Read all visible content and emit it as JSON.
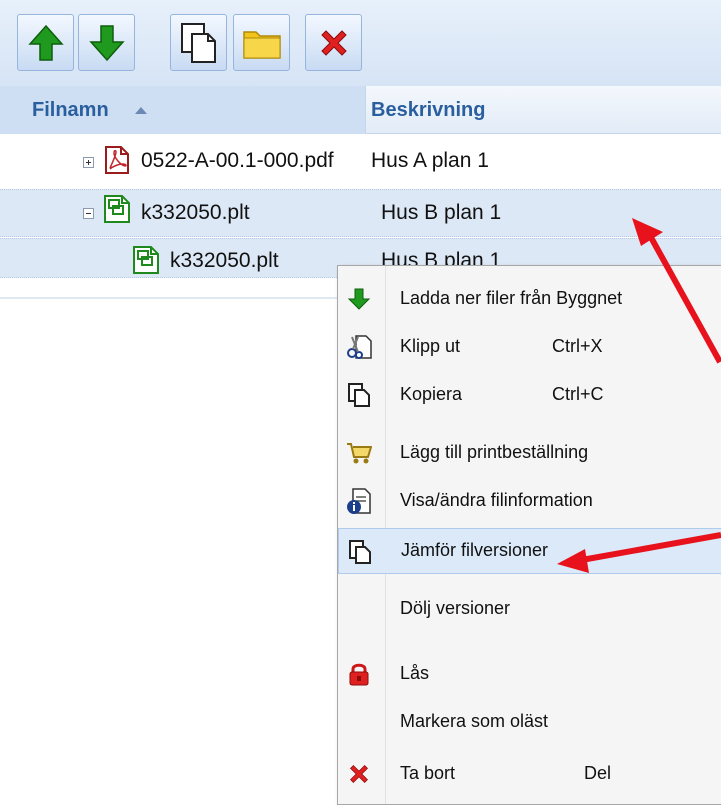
{
  "toolbar": {
    "buttons": [
      {
        "icon": "arrow-up-icon",
        "color": "#1f9a1f"
      },
      {
        "icon": "arrow-down-icon",
        "color": "#1f9a1f"
      },
      {
        "icon": "copy-icon"
      },
      {
        "icon": "folder-icon",
        "color": "#f2c318"
      },
      {
        "icon": "delete-icon",
        "color": "#e02020"
      }
    ]
  },
  "grid": {
    "columns": {
      "filename": "Filnamn",
      "description": "Beskrivning"
    },
    "rows": [
      {
        "name": "0522-A-00.1-000.pdf",
        "description": "Hus A plan 1",
        "icon": "pdf-file-icon",
        "expander": "plus",
        "selected": false
      },
      {
        "name": "k332050.plt",
        "description": "Hus B plan 1",
        "icon": "plt-file-icon",
        "expander": "minus",
        "selected": true
      },
      {
        "name": "k332050.plt",
        "description": "Hus B plan 1",
        "icon": "plt-file-icon",
        "expander": "none",
        "selected": true
      }
    ]
  },
  "context_menu": {
    "items": [
      {
        "label": "Ladda ner filer från Byggnet",
        "shortcut": "",
        "icon": "download-arrow-icon"
      },
      {
        "label": "Klipp ut",
        "shortcut": "Ctrl+X",
        "icon": "cut-icon"
      },
      {
        "label": "Kopiera",
        "shortcut": "Ctrl+C",
        "icon": "copy-icon"
      },
      {
        "label": "Lägg till printbeställning",
        "shortcut": "",
        "icon": "cart-icon"
      },
      {
        "label": "Visa/ändra filinformation",
        "shortcut": "",
        "icon": "file-info-icon"
      },
      {
        "label": "Jämför filversioner",
        "shortcut": "",
        "icon": "compare-icon",
        "highlighted": true
      },
      {
        "label": "Dölj versioner",
        "shortcut": "",
        "icon": ""
      },
      {
        "label": "Lås",
        "shortcut": "",
        "icon": "lock-icon"
      },
      {
        "label": "Markera som oläst",
        "shortcut": "",
        "icon": ""
      },
      {
        "label": "Ta bort",
        "shortcut": "Del",
        "icon": "delete-icon"
      }
    ]
  },
  "annotation_color": "#e8121c"
}
